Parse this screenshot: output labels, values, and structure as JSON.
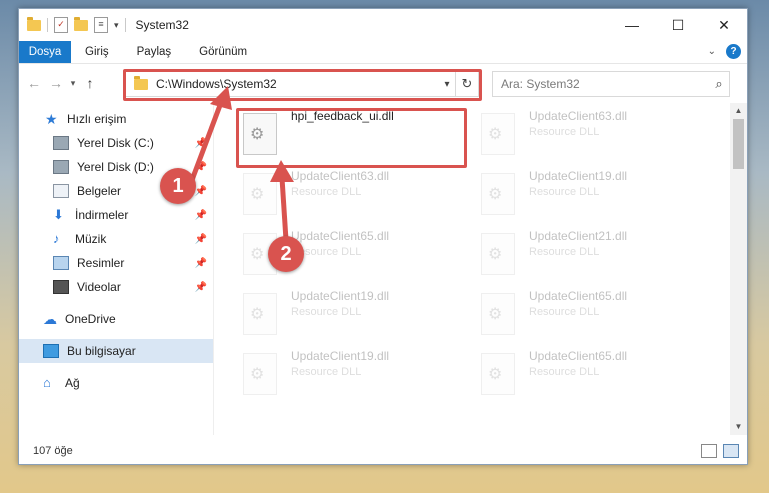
{
  "window": {
    "title": "System32",
    "controls": {
      "minimize": "—",
      "maximize": "☐",
      "close": "✕"
    }
  },
  "ribbon": {
    "tabs": [
      "Dosya",
      "Giriş",
      "Paylaş",
      "Görünüm"
    ]
  },
  "address_bar": {
    "path": "C:\\Windows\\System32",
    "search_placeholder": "Ara: System32"
  },
  "sidebar": {
    "quick_access": "Hızlı erişim",
    "items": [
      {
        "label": "Yerel Disk (C:)",
        "icon": "drive-icon",
        "pinned": true
      },
      {
        "label": "Yerel Disk (D:)",
        "icon": "drive-icon",
        "pinned": true
      },
      {
        "label": "Belgeler",
        "icon": "documents-icon",
        "pinned": true
      },
      {
        "label": "İndirmeler",
        "icon": "download-icon",
        "pinned": true
      },
      {
        "label": "Müzik",
        "icon": "music-icon",
        "pinned": true
      },
      {
        "label": "Resimler",
        "icon": "pictures-icon",
        "pinned": true
      },
      {
        "label": "Videolar",
        "icon": "videos-icon",
        "pinned": true
      }
    ],
    "onedrive": "OneDrive",
    "this_pc": "Bu bilgisayar",
    "network": "Ağ"
  },
  "files": [
    {
      "name": "hpi_feedback_ui.dll",
      "type": "",
      "highlighted": true
    },
    {
      "name": "UpdateClient63.dll",
      "type": "Resource DLL"
    },
    {
      "name": "UpdateClient63.dll",
      "type": "Resource DLL"
    },
    {
      "name": "UpdateClient19.dll",
      "type": "Resource DLL"
    },
    {
      "name": "UpdateClient65.dll",
      "type": "Resource DLL"
    },
    {
      "name": "UpdateClient21.dll",
      "type": "Resource DLL"
    },
    {
      "name": "UpdateClient19.dll",
      "type": "Resource DLL"
    },
    {
      "name": "UpdateClient65.dll",
      "type": "Resource DLL"
    },
    {
      "name": "UpdateClient19.dll",
      "type": "Resource DLL"
    },
    {
      "name": "UpdateClient65.dll",
      "type": "Resource DLL"
    }
  ],
  "status": {
    "count": "107 öğe"
  },
  "annotations": {
    "step1": "1",
    "step2": "2",
    "color": "#d9534f"
  }
}
